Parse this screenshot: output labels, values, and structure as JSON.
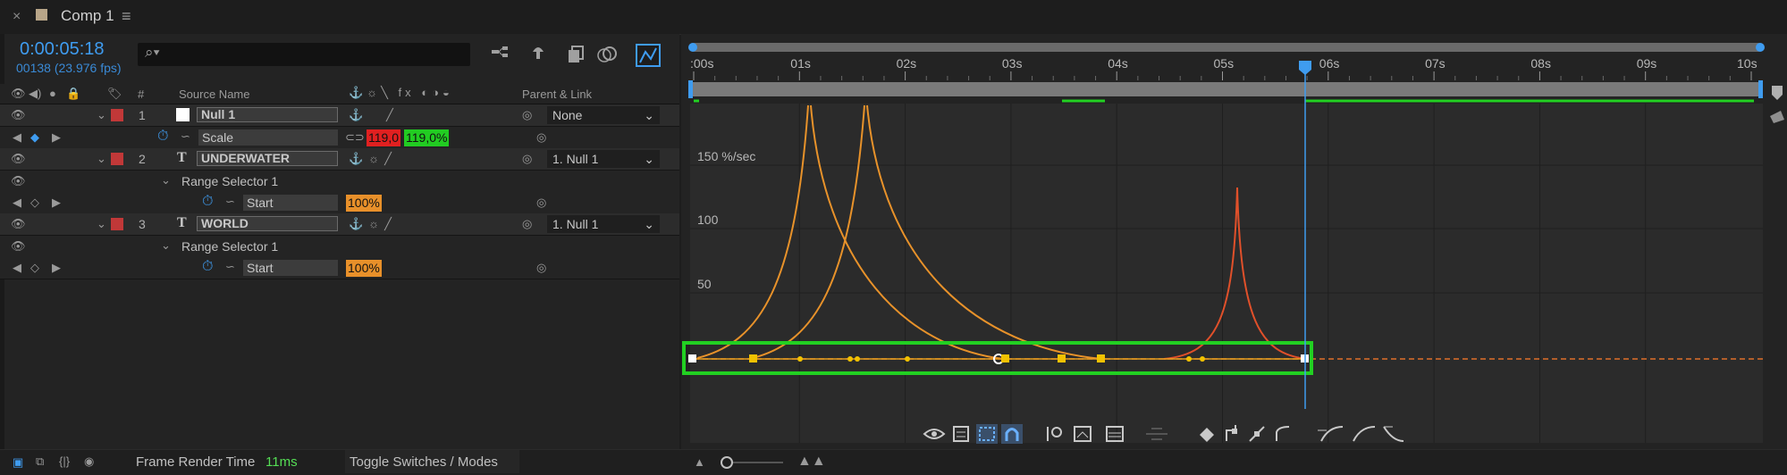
{
  "tab": {
    "title": "Comp 1"
  },
  "header": {
    "timecode": "0:00:05:18",
    "frame_info": "00138 (23.976 fps)",
    "search_placeholder": ""
  },
  "columns": {
    "num": "#",
    "source_name": "Source Name",
    "parent": "Parent & Link"
  },
  "layers": [
    {
      "index": "1",
      "name": "Null 1",
      "parent": "None"
    },
    {
      "index": "2",
      "name": "UNDERWATER",
      "parent": "1. Null 1"
    },
    {
      "index": "3",
      "name": "WORLD",
      "parent": "1. Null 1"
    }
  ],
  "scale": {
    "label": "Scale",
    "value_x": "119,0",
    "value_y": "119,0%"
  },
  "range_selector": {
    "label": "Range Selector 1"
  },
  "start": {
    "label": "Start",
    "value": "100%"
  },
  "timeline": {
    "ruler_labels": [
      ":00s",
      "01s",
      "02s",
      "03s",
      "04s",
      "05s",
      "06s",
      "07s",
      "08s",
      "09s",
      "10s"
    ],
    "y_labels": [
      "150 %/sec",
      "100",
      "50"
    ]
  },
  "status": {
    "frame_render_label": "Frame Render Time",
    "frame_render_value": "11ms",
    "toggle_label": "Toggle Switches / Modes"
  },
  "colors": {
    "accent": "#3f9cf0",
    "curve_orange": "#e8922a",
    "curve_red": "#e0502a",
    "highlight_green": "#22d022",
    "keyframe_yellow": "#f2c200",
    "scale_red": "#e02020",
    "scale_green": "#22cc22",
    "value_orange": "#e8902a"
  }
}
